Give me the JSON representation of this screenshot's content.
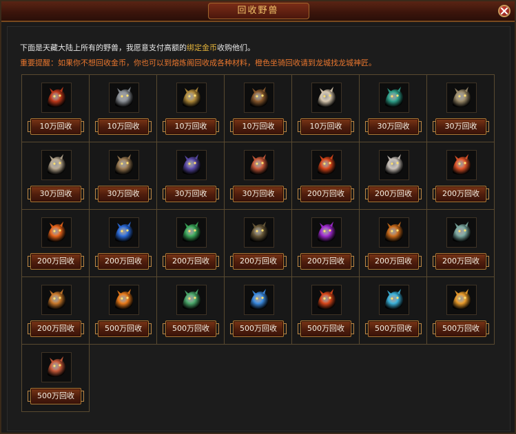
{
  "window": {
    "title": "回收野兽"
  },
  "intro": {
    "prefix": "下面是天藏大陆上所有的野兽，我愿意支付高额的",
    "highlight": "绑定金币",
    "suffix": "收购他们。"
  },
  "tip": "重要提醒：如果你不想回收金币，你也可以到熔炼阁回收成各种材料，橙色坐骑回收请到龙城找龙城神匠。",
  "beasts": [
    {
      "label": "10万回收",
      "color": "#c0391b"
    },
    {
      "label": "10万回收",
      "color": "#8a8f95"
    },
    {
      "label": "10万回收",
      "color": "#b08a3a"
    },
    {
      "label": "10万回收",
      "color": "#8a5a2e"
    },
    {
      "label": "10万回收",
      "color": "#d8c8b0"
    },
    {
      "label": "30万回收",
      "color": "#2ea08a"
    },
    {
      "label": "30万回收",
      "color": "#9a8a6a"
    },
    {
      "label": "30万回收",
      "color": "#b8a890"
    },
    {
      "label": "30万回收",
      "color": "#9a7a52"
    },
    {
      "label": "30万回收",
      "color": "#5a4aa8"
    },
    {
      "label": "30万回收",
      "color": "#c85a3a"
    },
    {
      "label": "200万回收",
      "color": "#d8461a"
    },
    {
      "label": "200万回收",
      "color": "#c8c0b8"
    },
    {
      "label": "200万回收",
      "color": "#e0542a"
    },
    {
      "label": "200万回收",
      "color": "#e8641a"
    },
    {
      "label": "200万回收",
      "color": "#2a6ad8"
    },
    {
      "label": "200万回收",
      "color": "#3aa85a"
    },
    {
      "label": "200万回收",
      "color": "#6a5a3a"
    },
    {
      "label": "200万回收",
      "color": "#a02ad0"
    },
    {
      "label": "200万回收",
      "color": "#c86a1a"
    },
    {
      "label": "200万回收",
      "color": "#7aa8a0"
    },
    {
      "label": "200万回收",
      "color": "#c8782a"
    },
    {
      "label": "500万回收",
      "color": "#e87a1a"
    },
    {
      "label": "500万回收",
      "color": "#4aa86a"
    },
    {
      "label": "500万回收",
      "color": "#3a8ae0"
    },
    {
      "label": "500万回收",
      "color": "#d8461a"
    },
    {
      "label": "500万回收",
      "color": "#3ab0d8"
    },
    {
      "label": "500万回收",
      "color": "#e89a2a"
    },
    {
      "label": "500万回收",
      "color": "#c85a3a"
    }
  ]
}
